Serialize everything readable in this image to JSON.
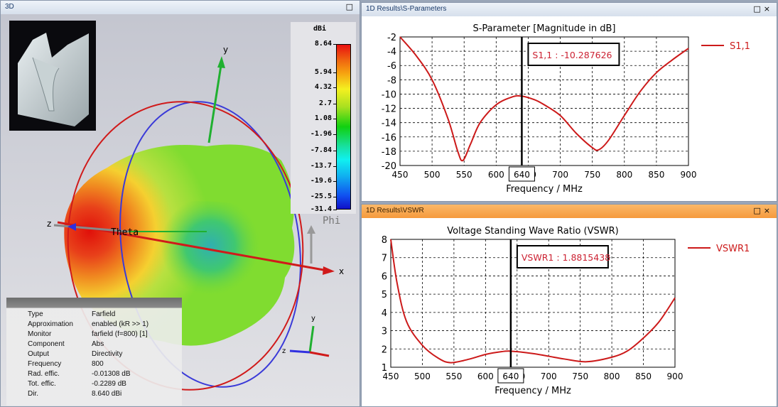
{
  "left_pane": {
    "title": "3D",
    "axes": {
      "x": "x",
      "y": "y",
      "z": "z",
      "theta": "Theta",
      "phi": "Phi"
    },
    "colorbar": {
      "unit": "dBi",
      "ticks": [
        "8.64",
        "5.94",
        "4.32",
        "2.7",
        "1.08",
        "-1.96",
        "-7.84",
        "-13.7",
        "-19.6",
        "-25.5",
        "-31.4"
      ]
    },
    "info": [
      {
        "label": "Type",
        "value": "Farfield"
      },
      {
        "label": "Approximation",
        "value": "enabled (kR >> 1)"
      },
      {
        "label": "Monitor",
        "value": "farfield (f=800) [1]"
      },
      {
        "label": "Component",
        "value": "Abs"
      },
      {
        "label": "Output",
        "value": "Directivity"
      },
      {
        "label": "Frequency",
        "value": "800"
      },
      {
        "label": "Rad. effic.",
        "value": "-0.01308 dB"
      },
      {
        "label": "Tot. effic.",
        "value": "-0.2289 dB"
      },
      {
        "label": "Dir.",
        "value": "8.640 dBi"
      }
    ]
  },
  "window_buttons": {
    "maximize": "□",
    "close": "×"
  },
  "sparam_pane": {
    "title": "1D Results\\S-Parameters",
    "active": false
  },
  "vswr_pane": {
    "title": "1D Results\\VSWR",
    "active": true
  },
  "accent": {
    "curve": "#cc1a1a",
    "active_title": "#f59a3c"
  },
  "chart_data": [
    {
      "type": "line",
      "title": "S-Parameter [Magnitude in dB]",
      "xlabel": "Frequency / MHz",
      "ylabel": "",
      "xlim": [
        450,
        900
      ],
      "ylim": [
        -20,
        -2
      ],
      "xticks": [
        450,
        500,
        550,
        600,
        650,
        700,
        750,
        800,
        850,
        900
      ],
      "yticks": [
        -2,
        -4,
        -6,
        -8,
        -10,
        -12,
        -14,
        -16,
        -18,
        -20
      ],
      "grid": true,
      "legend": "right",
      "marker": {
        "x": 640,
        "x_label": "640",
        "readout": "S1,1 : -10.287626"
      },
      "series": [
        {
          "name": "S1,1",
          "color": "#cc1a1a",
          "x": [
            450,
            475,
            500,
            525,
            540,
            548,
            560,
            575,
            600,
            625,
            640,
            660,
            675,
            700,
            725,
            750,
            760,
            775,
            800,
            825,
            850,
            875,
            900
          ],
          "y": [
            -2,
            -4.6,
            -8,
            -13.5,
            -18,
            -19.3,
            -17,
            -14,
            -11.5,
            -10.4,
            -10.29,
            -10.8,
            -11.5,
            -13,
            -15.5,
            -17.5,
            -17.8,
            -16.5,
            -13,
            -9.6,
            -7,
            -5.2,
            -3.6
          ]
        }
      ]
    },
    {
      "type": "line",
      "title": "Voltage Standing Wave Ratio (VSWR)",
      "xlabel": "Frequency / MHz",
      "ylabel": "",
      "xlim": [
        450,
        900
      ],
      "ylim": [
        1,
        8
      ],
      "xticks": [
        450,
        500,
        550,
        600,
        650,
        700,
        750,
        800,
        850,
        900
      ],
      "yticks": [
        8,
        7,
        6,
        5,
        4,
        3,
        2,
        1
      ],
      "grid": true,
      "legend": "right",
      "marker": {
        "x": 640,
        "x_label": "640",
        "readout": "VSWR1 : 1.8815438"
      },
      "series": [
        {
          "name": "VSWR1",
          "color": "#cc1a1a",
          "x": [
            450,
            460,
            475,
            500,
            525,
            545,
            575,
            600,
            625,
            640,
            675,
            700,
            725,
            760,
            800,
            825,
            850,
            875,
            900
          ],
          "y": [
            8,
            5.6,
            3.5,
            2.2,
            1.5,
            1.25,
            1.45,
            1.7,
            1.85,
            1.88,
            1.75,
            1.6,
            1.45,
            1.3,
            1.55,
            1.9,
            2.6,
            3.5,
            4.8
          ]
        }
      ]
    }
  ]
}
